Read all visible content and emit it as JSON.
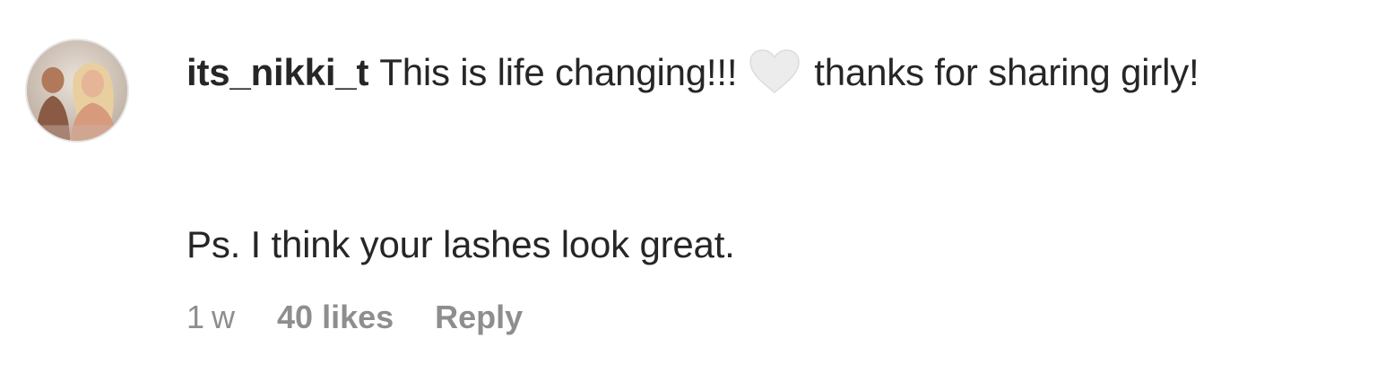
{
  "comment": {
    "username": "its_nikki_t",
    "text_before_emoji": "This is life changing!!!",
    "emoji": "white-heart-icon",
    "text_after_emoji": "thanks for sharing girly!",
    "second_paragraph": "Ps. I think your lashes look great.",
    "time": "1 w",
    "likes": "40 likes",
    "reply_label": "Reply"
  },
  "colors": {
    "text": "#262626",
    "meta": "#8e8e8e",
    "heart": "#e8e8e8"
  }
}
